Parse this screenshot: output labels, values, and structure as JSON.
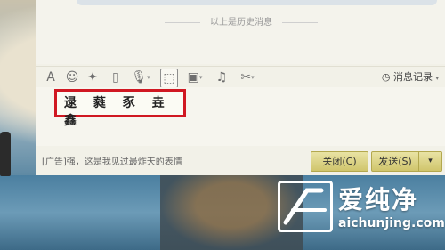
{
  "history": {
    "label": "以上是历史消息"
  },
  "toolbar": {
    "history_button": "消息记录",
    "caret": "▾"
  },
  "input": {
    "glyphs": [
      "逯",
      "蕤",
      "豕",
      "垚",
      "鑫"
    ]
  },
  "ad": {
    "text": "[广告]强，这是我见过最炸天的表情"
  },
  "buttons": {
    "close": "关闭(C)",
    "send": "发送(S)",
    "send_dropdown": "▾"
  },
  "watermark": {
    "brand": "爱纯净",
    "url": "aichunjing.com"
  }
}
